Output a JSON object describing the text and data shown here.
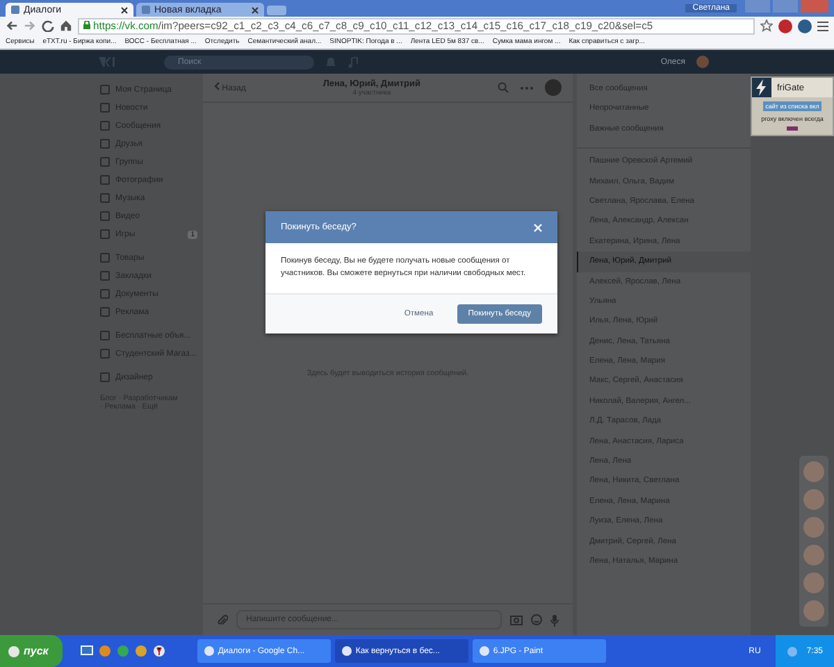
{
  "browser": {
    "tabs": [
      {
        "label": "Диалоги",
        "selected": true
      },
      {
        "label": "Новая вкладка",
        "selected": false
      }
    ],
    "profile": "Светлана",
    "url_host": "https://vk.com",
    "url_path": "/im?peers=c92_c1_c2_c3_c4_c6_c7_c8_c9_c10_c11_c12_c13_c14_c15_c16_c17_c18_c19_c20&sel=c5",
    "bookmarks": [
      "Сервисы",
      "eTXT.ru - Биржа копи...",
      "ВОСС - Бесплатная ...",
      "Отследить",
      "Семантический анал...",
      "SINOPTIK: Погода в ...",
      "Лента LED 5м 837 св...",
      "Сумка мама ингом ...",
      "Как справиться с загр..."
    ]
  },
  "header": {
    "search": {
      "placeholder": "Поиск"
    },
    "user": "Олеся"
  },
  "sidebar": {
    "groups": [
      [
        {
          "label": "Моя Страница"
        },
        {
          "label": "Новости"
        },
        {
          "label": "Сообщения"
        },
        {
          "label": "Друзья"
        },
        {
          "label": "Группы"
        },
        {
          "label": "Фотографии"
        },
        {
          "label": "Музыка"
        },
        {
          "label": "Видео"
        },
        {
          "label": "Игры",
          "badge": "1"
        }
      ],
      [
        {
          "label": "Товары"
        },
        {
          "label": "Закладки"
        },
        {
          "label": "Документы"
        },
        {
          "label": "Реклама"
        }
      ],
      [
        {
          "label": "Бесплатные объя..."
        },
        {
          "label": "Студентский Магаз..."
        }
      ],
      [
        {
          "label": "Дизайнер"
        }
      ]
    ],
    "footer": "Блог · Разработчикам · Реклама · Ещё"
  },
  "chat": {
    "back": "Назад",
    "title": "Лена, Юрий, Дмитрий",
    "subtitle": "4 участника",
    "empty": "Здесь будет выводиться история сообщений.",
    "input": {
      "placeholder": "Напишите сообщение..."
    }
  },
  "dialog": {
    "title": "Покинуть беседу?",
    "text": "Покинув беседу, Вы не будете получать новые сообщения от участников. Вы сможете вернуться при наличии свободных мест.",
    "buttons": [
      {
        "label": "Отмена",
        "kind": "secondary"
      },
      {
        "label": "Покинуть беседу",
        "kind": "primary"
      }
    ]
  },
  "filters": [
    {
      "label": "Все сообщения"
    },
    {
      "label": "Непрочитанные"
    },
    {
      "label": "Важные сообщения"
    }
  ],
  "conversations": [
    {
      "label": "Пашние Оревской Артемий",
      "selected": false
    },
    {
      "label": "Михаил, Ольга, Вадим",
      "selected": false
    },
    {
      "label": "Светлана, Ярослава, Елена",
      "selected": false
    },
    {
      "label": "Лена, Александр, Алексан",
      "selected": false
    },
    {
      "label": "Екатерина, Ирина, Лена",
      "selected": false
    },
    {
      "label": "Лена, Юрий, Дмитрий",
      "selected": true
    },
    {
      "label": "Алексей, Ярослав, Лена",
      "selected": false
    },
    {
      "label": "Ульяна",
      "selected": false
    },
    {
      "label": "Илья, Лена, Юрий",
      "selected": false
    },
    {
      "label": "Денис, Лена, Татьяна",
      "selected": false
    },
    {
      "label": "Елена, Лена, Мария",
      "selected": false
    },
    {
      "label": "Макс, Сергей, Анастасия",
      "selected": false
    },
    {
      "label": "Николай, Валерия, Ангел...",
      "selected": false
    },
    {
      "label": "Л.Д. Тарасов, Лада",
      "selected": false
    },
    {
      "label": "Лена, Анастасия, Лариса",
      "selected": false
    },
    {
      "label": "Лена, Лена",
      "selected": false
    },
    {
      "label": "Лена, Никита, Светлана",
      "selected": false
    },
    {
      "label": "Елена, Лена, Марина",
      "selected": false
    },
    {
      "label": "Луиза, Елена, Лена",
      "selected": false
    },
    {
      "label": "Дмитрий, Сергей, Лена",
      "selected": false
    },
    {
      "label": "Лена, Наталья, Марина",
      "selected": false
    }
  ],
  "frigate": {
    "title": "friGate",
    "status": "сайт из списка вкл",
    "note": "proxy включен всегда"
  },
  "taskbar": {
    "start": "пуск",
    "tasks": [
      {
        "label": "Диалоги - Google Ch...",
        "selected": false
      },
      {
        "label": "Как вернуться в бес...",
        "selected": true
      },
      {
        "label": "6.JPG - Paint",
        "selected": false
      }
    ],
    "lang": "RU",
    "clock": "7:35"
  }
}
